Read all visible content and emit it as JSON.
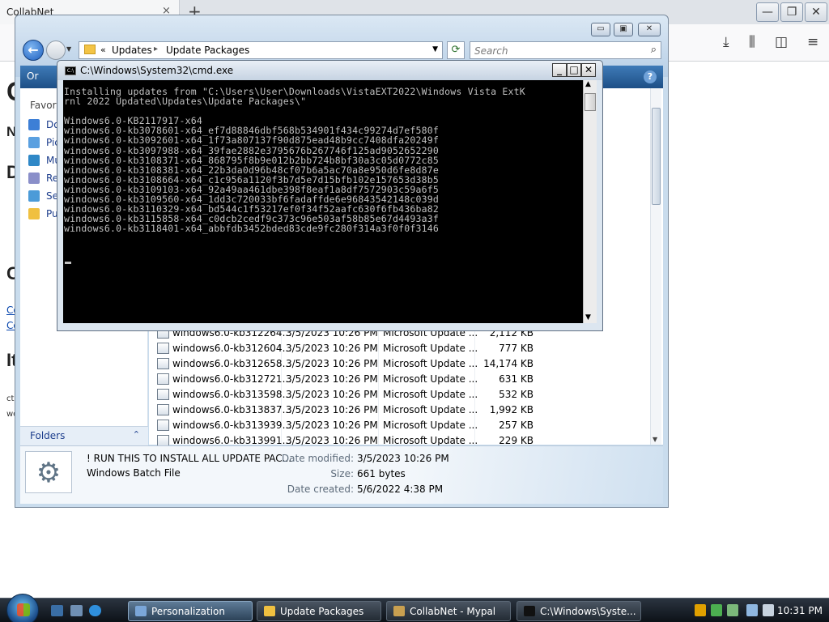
{
  "firefox": {
    "tab_title": "CollabNet",
    "tab_close": "×",
    "new_tab": "+",
    "page_letters": [
      "C",
      "N",
      "D",
      "C",
      "It"
    ],
    "links": [
      "Co",
      "Co"
    ],
    "small_text": [
      "ct",
      "wc"
    ]
  },
  "explorer": {
    "address": {
      "chevron": "«",
      "crumbs": [
        "Updates",
        "Update Packages"
      ],
      "separator": "▸"
    },
    "search_placeholder": "Search",
    "organize_label": "Or",
    "help": "?",
    "favorites_heading": "Favori",
    "favorites": [
      {
        "label": "Do",
        "color": "#3d7fd6"
      },
      {
        "label": "Pic",
        "color": "#5aa0e0"
      },
      {
        "label": "Mu",
        "color": "#2f88c7"
      },
      {
        "label": "Re",
        "color": "#8a8fc9"
      },
      {
        "label": "Se",
        "color": "#4c9bd8"
      },
      {
        "label": "Pu",
        "color": "#f0c040"
      }
    ],
    "folders_label": "Folders",
    "folders_chevron": "⌃",
    "files": [
      {
        "name": "windows6.0-kb312264...",
        "date": "3/5/2023 10:26 PM",
        "type": "Microsoft Update ...",
        "size": "2,112 KB"
      },
      {
        "name": "windows6.0-kb312604...",
        "date": "3/5/2023 10:26 PM",
        "type": "Microsoft Update ...",
        "size": "777 KB"
      },
      {
        "name": "windows6.0-kb312658...",
        "date": "3/5/2023 10:26 PM",
        "type": "Microsoft Update ...",
        "size": "14,174 KB"
      },
      {
        "name": "windows6.0-kb312721...",
        "date": "3/5/2023 10:26 PM",
        "type": "Microsoft Update ...",
        "size": "631 KB"
      },
      {
        "name": "windows6.0-kb313598...",
        "date": "3/5/2023 10:26 PM",
        "type": "Microsoft Update ...",
        "size": "532 KB"
      },
      {
        "name": "windows6.0-kb313837...",
        "date": "3/5/2023 10:26 PM",
        "type": "Microsoft Update ...",
        "size": "1,992 KB"
      },
      {
        "name": "windows6.0-kb313939...",
        "date": "3/5/2023 10:26 PM",
        "type": "Microsoft Update ...",
        "size": "257 KB"
      },
      {
        "name": "windows6.0-kb313991...",
        "date": "3/5/2023 10:26 PM",
        "type": "Microsoft Update ...",
        "size": "229 KB"
      }
    ],
    "details": {
      "name": "! RUN THIS TO INSTALL ALL UPDATE PAC...",
      "type": "Windows Batch File",
      "modified_label": "Date modified:",
      "modified_value": "3/5/2023 10:26 PM",
      "size_label": "Size:",
      "size_value": "661 bytes",
      "created_label": "Date created:",
      "created_value": "5/6/2022 4:38 PM"
    }
  },
  "cmd": {
    "title": "C:\\Windows\\System32\\cmd.exe",
    "icon_text": "C:\\",
    "output": "Installing updates from \"C:\\Users\\User\\Downloads\\VistaEXT2022\\Windows Vista ExtK\nrnl 2022 Updated\\Updates\\Update Packages\\\"\n\nWindows6.0-KB2117917-x64\nwindows6.0-kb3078601-x64_ef7d88846dbf568b534901f434c99274d7ef580f\nwindows6.0-kb3092601-x64_1f73a807137f90d875ead48b9cc7408dfa20249f\nwindows6.0-kb3097988-x64_39fae2882e3795676b267746f125ad9052652290\nwindows6.0-kb3108371-x64_868795f8b9e012b2bb724b8bf30a3c05d0772c85\nwindows6.0-kb3108381-x64_22b3da0d96b48cf07b6a5ac70a8e950d6fe8d87e\nwindows6.0-kb3108664-x64_c1c956a1120f3b7d5e7d15bfb102e157653d38b5\nwindows6.0-kb3109103-x64_92a49aa461dbe398f8eaf1a8df7572903c59a6f5\nwindows6.0-kb3109560-x64_1dd3c720033bf6fadaffde6e96843542148c039d\nwindows6.0-kb3110329-x64_bd544c1f53217ef0f34f52aafc630f6fb436ba82\nwindows6.0-kb3115858-x64_c0dcb2cedf9c373c96e503af58b85e67d4493a3f\nwindows6.0-kb3118401-x64_abbfdb3452bded83cde9fc280f314a3f0f0f3146"
  },
  "taskbar": {
    "buttons": [
      {
        "label": "Personalization",
        "color": "#7aa6d8"
      },
      {
        "label": "Update Packages",
        "color": "#f0c040"
      },
      {
        "label": "CollabNet - Mypal",
        "color": "#c9a050"
      },
      {
        "label": "C:\\Windows\\Syste...",
        "color": "#111111"
      }
    ],
    "clock": "10:31 PM"
  }
}
